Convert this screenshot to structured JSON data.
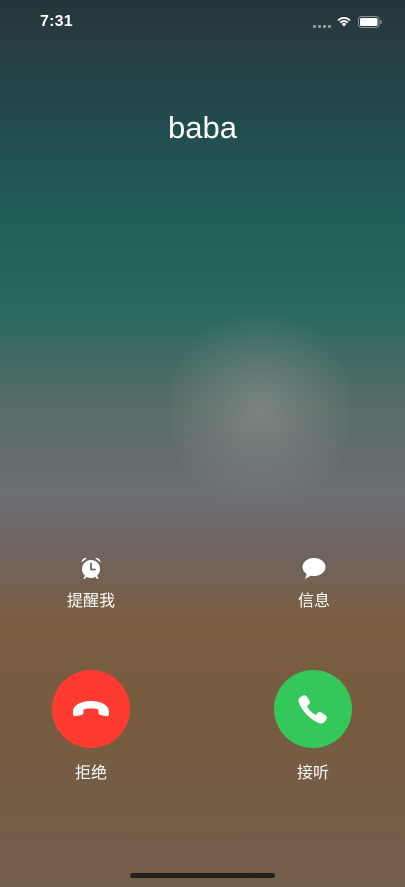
{
  "status_bar": {
    "time": "7:31",
    "signal_icon": "signal-dots-icon",
    "wifi_icon": "wifi-icon",
    "battery_icon": "battery-icon"
  },
  "caller": {
    "name": "baba"
  },
  "actions": {
    "remind": {
      "label": "提醒我",
      "icon": "alarm-clock-icon"
    },
    "message": {
      "label": "信息",
      "icon": "speech-bubble-icon"
    }
  },
  "call_controls": {
    "decline": {
      "label": "拒绝",
      "icon": "phone-hangup-icon",
      "color": "#fe3b30"
    },
    "accept": {
      "label": "接听",
      "icon": "phone-icon",
      "color": "#34c759"
    }
  }
}
